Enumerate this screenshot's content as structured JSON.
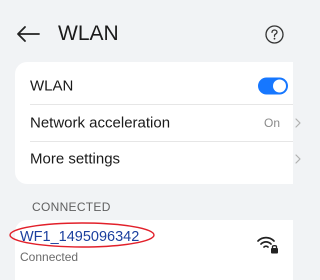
{
  "header": {
    "title": "WLAN",
    "back_icon": "arrow-left-icon",
    "help_icon": "question-circle-icon"
  },
  "settings": {
    "wlan": {
      "label": "WLAN",
      "enabled": true
    },
    "acceleration": {
      "label": "Network acceleration",
      "value": "On"
    },
    "more": {
      "label": "More settings"
    }
  },
  "connected": {
    "section_label": "CONNECTED",
    "network": {
      "ssid": "WF1_1495096342",
      "status": "Connected",
      "signal_icon": "wifi-locked-icon"
    }
  },
  "colors": {
    "accent": "#1677ff",
    "annotation": "#e2202a",
    "background": "#f1f3f5"
  }
}
